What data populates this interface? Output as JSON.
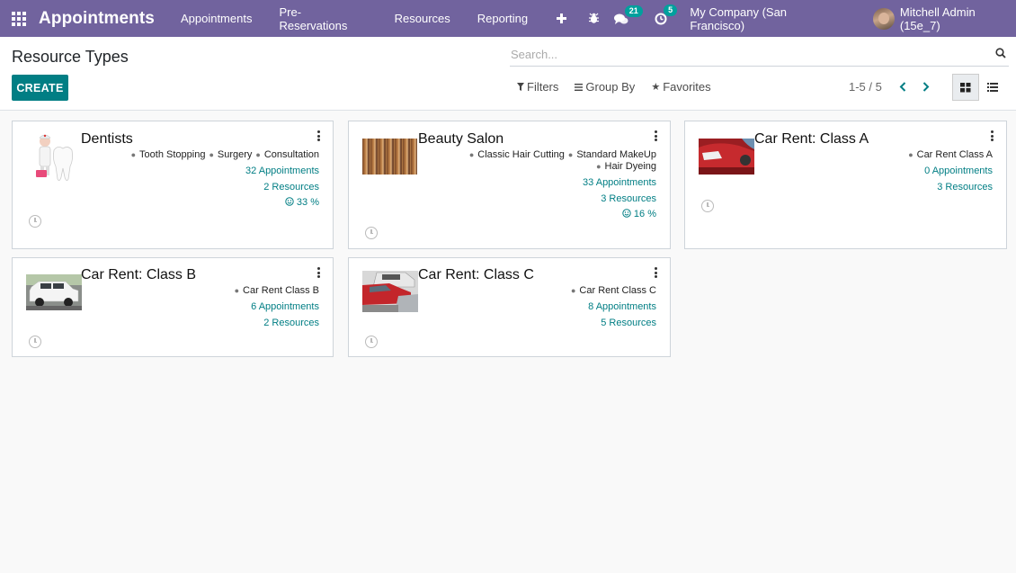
{
  "navbar": {
    "app_name": "Appointments",
    "menu": [
      "Appointments",
      "Pre-Reservations",
      "Resources",
      "Reporting"
    ],
    "messages_badge": "21",
    "activities_badge": "5",
    "company": "My Company (San Francisco)",
    "user": "Mitchell Admin (15e_7)"
  },
  "control_panel": {
    "title": "Resource Types",
    "search_placeholder": "Search...",
    "create_label": "CREATE",
    "filters_label": "Filters",
    "groupby_label": "Group By",
    "favorites_label": "Favorites",
    "pager": "1-5 / 5"
  },
  "cards": [
    {
      "title": "Dentists",
      "image": "dentist-icon",
      "tags": [
        "Tooth Stopping",
        "Surgery",
        "Consultation"
      ],
      "appointments": "32 Appointments",
      "resources": "2 Resources",
      "rating": "33 %"
    },
    {
      "title": "Beauty Salon",
      "image": "salon-photo",
      "tags": [
        "Classic Hair Cutting",
        "Standard MakeUp",
        "Hair Dyeing"
      ],
      "appointments": "33 Appointments",
      "resources": "3 Resources",
      "rating": "16 %"
    },
    {
      "title": "Car Rent: Class A",
      "image": "red-car-photo",
      "tags": [
        "Car Rent Class A"
      ],
      "appointments": "0 Appointments",
      "resources": "3 Resources"
    },
    {
      "title": "Car Rent: Class B",
      "image": "white-jeep-photo",
      "tags": [
        "Car Rent Class B"
      ],
      "appointments": "6 Appointments",
      "resources": "2 Resources"
    },
    {
      "title": "Car Rent: Class C",
      "image": "red-cars-photo",
      "tags": [
        "Car Rent Class C"
      ],
      "appointments": "8 Appointments",
      "resources": "5 Resources"
    }
  ],
  "colors": {
    "navbar": "#71639e",
    "primary": "#017e84",
    "badge": "#00a09d"
  }
}
